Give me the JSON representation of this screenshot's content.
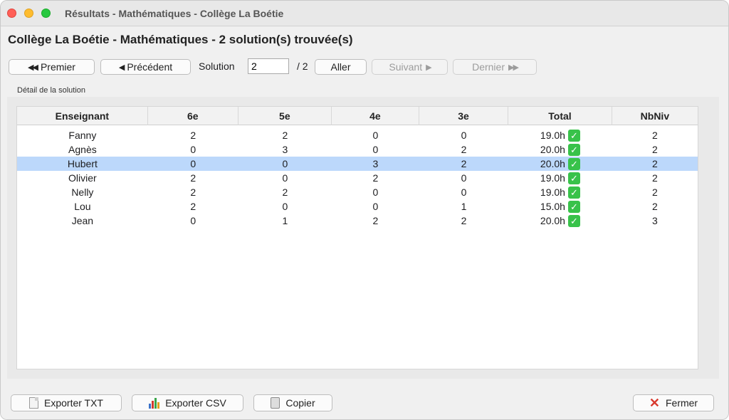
{
  "window": {
    "title": "Résultats - Mathématiques - Collège La Boétie"
  },
  "heading": "Collège La Boétie - Mathématiques - 2 solution(s) trouvée(s)",
  "nav": {
    "first_label": "Premier",
    "previous_label": "Précédent",
    "solution_label": "Solution",
    "solution_value": "2",
    "total_label": "/ 2",
    "go_label": "Aller",
    "next_label": "Suivant",
    "last_label": "Dernier"
  },
  "detail_label": "Détail de la solution",
  "table": {
    "columns": [
      "Enseignant",
      "6e",
      "5e",
      "4e",
      "3e",
      "Total",
      "NbNiv"
    ],
    "rows": [
      [
        "Fanny",
        "2",
        "2",
        "0",
        "0",
        "19.0h",
        "2"
      ],
      [
        "Agnès",
        "0",
        "3",
        "0",
        "2",
        "20.0h",
        "2"
      ],
      [
        "Hubert",
        "0",
        "0",
        "3",
        "2",
        "20.0h",
        "2"
      ],
      [
        "Olivier",
        "2",
        "0",
        "2",
        "0",
        "19.0h",
        "2"
      ],
      [
        "Nelly",
        "2",
        "2",
        "0",
        "0",
        "19.0h",
        "2"
      ],
      [
        "Lou",
        "2",
        "0",
        "0",
        "1",
        "15.0h",
        "2"
      ],
      [
        "Jean",
        "0",
        "1",
        "2",
        "2",
        "20.0h",
        "3"
      ]
    ],
    "selected_row": 2,
    "check_glyph": "✓"
  },
  "footer": {
    "export_txt_label": "Exporter TXT",
    "export_csv_label": "Exporter CSV",
    "copy_label": "Copier",
    "close_label": "Fermer"
  },
  "colors": {
    "selection": "#bcd8fb",
    "check": "#38c24a",
    "close_x": "#d93a2f"
  }
}
